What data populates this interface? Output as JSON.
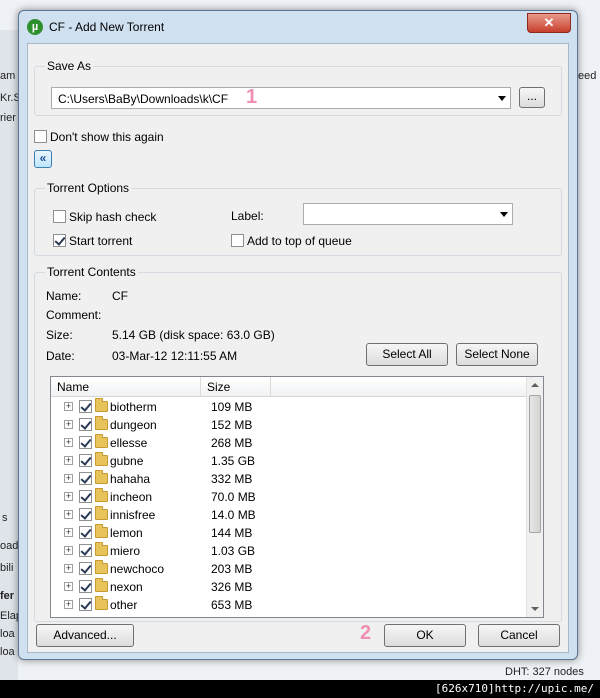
{
  "background_app": {
    "left_text": [
      "am",
      "Kr.S",
      "rier",
      "s",
      "oad",
      "bili",
      "fer",
      "Elap",
      "loa",
      "loa"
    ],
    "right_text": "eed",
    "status_text": "DHT: 327 nodes"
  },
  "footer_watermark": "[626x710]http://upic.me/",
  "dialog": {
    "title": "CF - Add New Torrent",
    "close_label": "✕",
    "save_as": {
      "group_label": "Save As",
      "path": "C:\\Users\\BaBy\\Downloads\\k\\CF",
      "browse_label": "..."
    },
    "dont_show_label": "Don't show this again",
    "collapse_label": "«",
    "options": {
      "group_label": "Torrent Options",
      "skip_hash_label": "Skip hash check",
      "skip_hash_checked": false,
      "start_torrent_label": "Start torrent",
      "start_torrent_checked": true,
      "label_caption": "Label:",
      "label_value": "",
      "add_top_label": "Add to top of queue",
      "add_top_checked": false
    },
    "contents": {
      "group_label": "Torrent Contents",
      "name_label": "Name:",
      "name_value": "CF",
      "comment_label": "Comment:",
      "comment_value": "",
      "size_label": "Size:",
      "size_value": "5.14 GB (disk space: 63.0 GB)",
      "date_label": "Date:",
      "date_value": "03-Mar-12 12:11:55 AM",
      "select_all_label": "Select All",
      "select_none_label": "Select None",
      "columns": [
        "Name",
        "Size"
      ],
      "files": [
        {
          "name": "biotherm",
          "size": "109 MB"
        },
        {
          "name": "dungeon",
          "size": "152 MB"
        },
        {
          "name": "ellesse",
          "size": "268 MB"
        },
        {
          "name": "gubne",
          "size": "1.35 GB"
        },
        {
          "name": "hahaha",
          "size": "332 MB"
        },
        {
          "name": "incheon",
          "size": "70.0 MB"
        },
        {
          "name": "innisfree",
          "size": "14.0 MB"
        },
        {
          "name": "lemon",
          "size": "144 MB"
        },
        {
          "name": "miero",
          "size": "1.03 GB"
        },
        {
          "name": "newchoco",
          "size": "203 MB"
        },
        {
          "name": "nexon",
          "size": "326 MB"
        },
        {
          "name": "other",
          "size": "653 MB"
        }
      ]
    },
    "advanced_label": "Advanced...",
    "ok_label": "OK",
    "cancel_label": "Cancel",
    "marker_1": "1",
    "marker_2": "2",
    "expand_glyph": "+"
  }
}
